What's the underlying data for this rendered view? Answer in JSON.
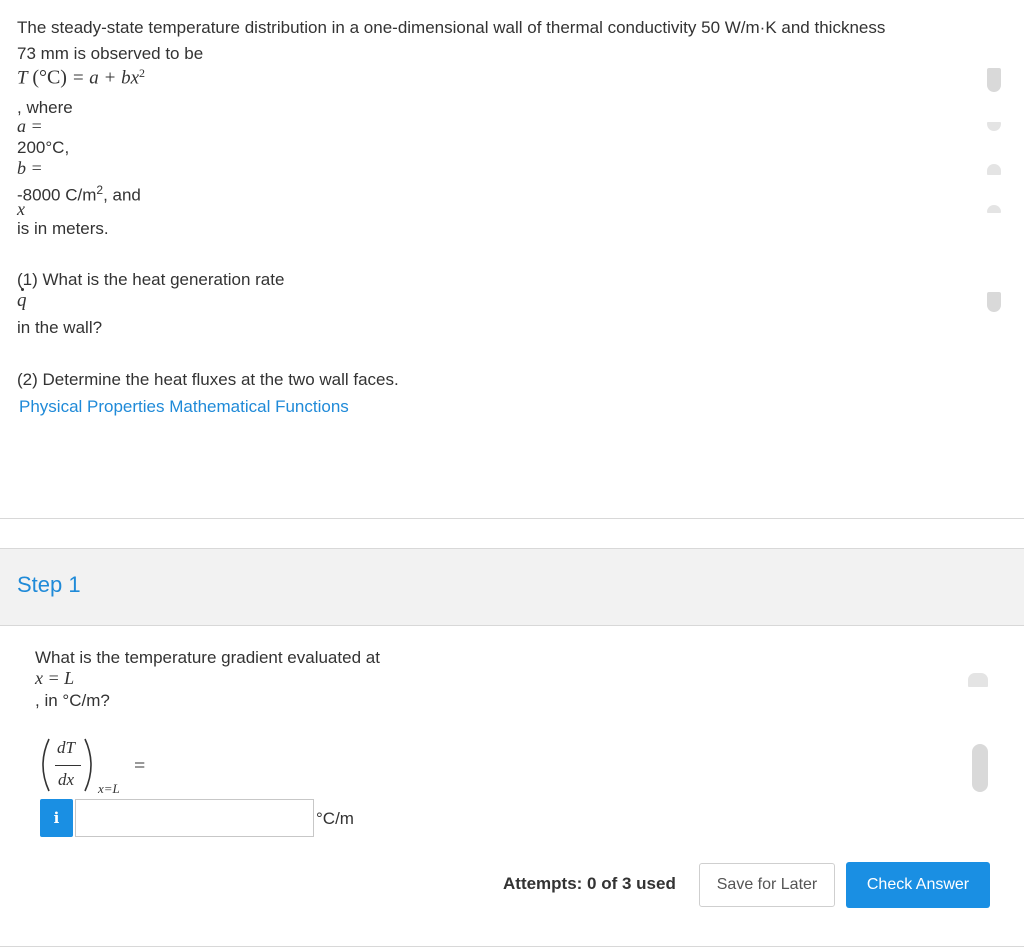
{
  "problem": {
    "intro_line1": "The steady-state temperature distribution in a one-dimensional wall of thermal conductivity 50 W/m·K and thickness",
    "intro_line2": "73 mm is observed to be",
    "eq_T": "T",
    "eq_unit": "(°C)",
    "eq_rhs": "= a + bx",
    "eq_exp": "2",
    "where": ", where",
    "a_sym": "a =",
    "a_val": "200°C,",
    "b_sym": "b =",
    "b_val": "-8000 C/m",
    "b_exp": "2",
    "b_tail": ", and",
    "x_sym": "x",
    "x_desc": "is in meters.",
    "q1": "(1) What is the heat generation rate",
    "q_sym": "q",
    "q1_tail": "in the wall?",
    "q2": "(2) Determine the heat fluxes at the two wall faces.",
    "link_properties": "Physical Properties",
    "link_functions": "Mathematical Functions"
  },
  "step": {
    "title": "Step 1",
    "question": "What is the temperature gradient evaluated at",
    "cond": "x = L",
    "question_tail": ", in °C/m?",
    "frac_num": "dT",
    "frac_den": "dx",
    "subscript": "x=L",
    "equals": "=",
    "info_label": "i",
    "answer_value": "",
    "unit": "°C/m"
  },
  "footer": {
    "attempts": "Attempts: 0 of 3 used",
    "save_label": "Save for Later",
    "check_label": "Check Answer"
  },
  "colors": {
    "link": "#1f8ad8",
    "primary_button": "#1a8fe3"
  }
}
